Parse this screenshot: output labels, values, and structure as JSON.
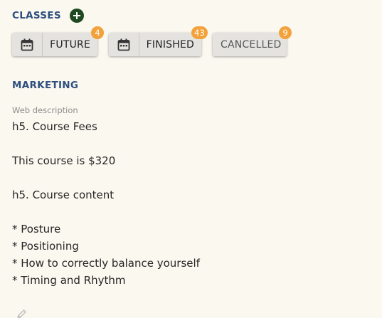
{
  "classes": {
    "title": "CLASSES",
    "add_icon": "plus-circle-icon",
    "tabs": [
      {
        "label": "FUTURE",
        "count": "4",
        "icon": "calendar-icon"
      },
      {
        "label": "FINISHED",
        "count": "43",
        "icon": "calendar-icon"
      },
      {
        "label": "CANCELLED",
        "count": "9"
      }
    ]
  },
  "marketing": {
    "title": "MARKETING",
    "web_description": {
      "label": "Web description",
      "lines": [
        "h5. Course Fees",
        "",
        "This course is $320",
        "",
        "h5. Course content",
        "",
        "* Posture",
        "* Positioning",
        "* How to correctly balance yourself",
        "* Timing and Rhythm"
      ]
    },
    "edit_icon": "pencil-icon"
  },
  "colors": {
    "background": "#fbf8f0",
    "heading": "#2f4f7f",
    "add_button": "#1f4a20",
    "badge": "#f3a13a",
    "chip": "#e4e3df"
  }
}
